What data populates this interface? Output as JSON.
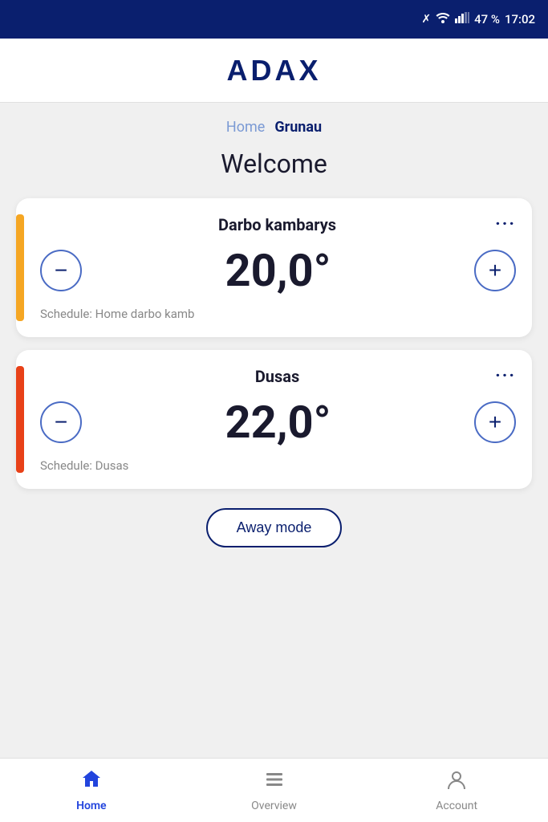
{
  "statusBar": {
    "battery": "47 %",
    "time": "17:02"
  },
  "header": {
    "logo": "ADAX"
  },
  "breadcrumb": {
    "home": "Home",
    "current": "Grunau"
  },
  "welcome": {
    "title": "Welcome"
  },
  "cards": [
    {
      "id": "card-darbo",
      "name": "Darbo kambarys",
      "temperature": "20,0°",
      "schedule": "Schedule: Home darbo kamb",
      "indicatorColor": "yellow",
      "decreaseLabel": "−",
      "increaseLabel": "+"
    },
    {
      "id": "card-dusas",
      "name": "Dusas",
      "temperature": "22,0°",
      "schedule": "Schedule: Dusas",
      "indicatorColor": "orange-red",
      "decreaseLabel": "−",
      "increaseLabel": "+"
    }
  ],
  "awayMode": {
    "label": "Away mode"
  },
  "bottomNav": {
    "items": [
      {
        "id": "home",
        "label": "Home",
        "active": true
      },
      {
        "id": "overview",
        "label": "Overview",
        "active": false
      },
      {
        "id": "account",
        "label": "Account",
        "active": false
      }
    ]
  }
}
